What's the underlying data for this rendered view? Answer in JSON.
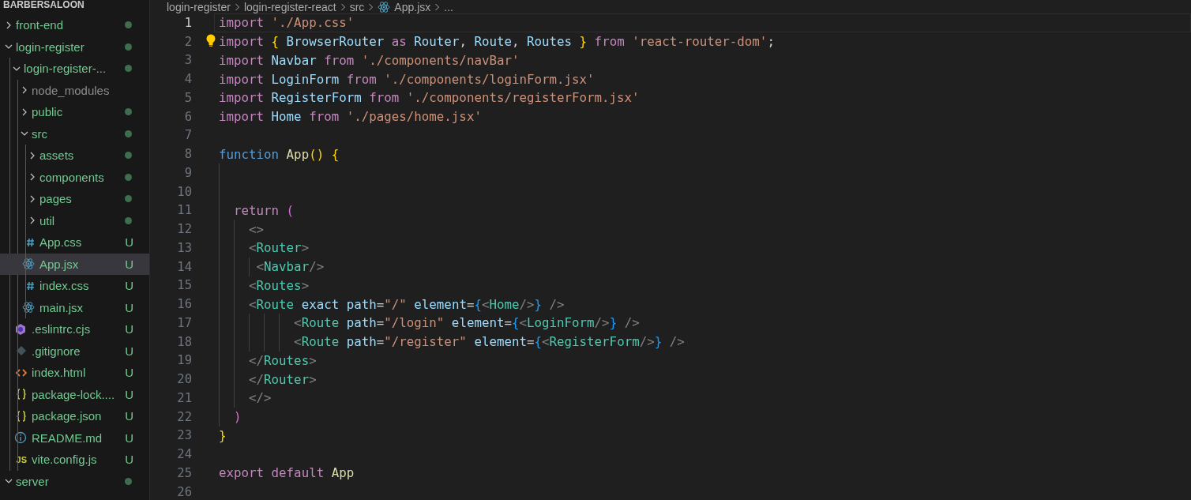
{
  "explorer": {
    "title": "BARBERSALOON",
    "tree": [
      {
        "name": "front-end",
        "kind": "folder",
        "expanded": false,
        "dot": true
      },
      {
        "name": "login-register",
        "kind": "folder",
        "expanded": true,
        "dot": true,
        "children": [
          {
            "name": "login-register-...",
            "kind": "folder",
            "expanded": true,
            "dot": true,
            "children": [
              {
                "name": "node_modules",
                "kind": "folder",
                "expanded": false,
                "dot": false,
                "dimmed": true
              },
              {
                "name": "public",
                "kind": "folder",
                "expanded": false,
                "dot": true
              },
              {
                "name": "src",
                "kind": "folder",
                "expanded": true,
                "dot": true,
                "children": [
                  {
                    "name": "assets",
                    "kind": "folder",
                    "expanded": false,
                    "dot": true
                  },
                  {
                    "name": "components",
                    "kind": "folder",
                    "expanded": false,
                    "dot": true
                  },
                  {
                    "name": "pages",
                    "kind": "folder",
                    "expanded": false,
                    "dot": true
                  },
                  {
                    "name": "util",
                    "kind": "folder",
                    "expanded": false,
                    "dot": true
                  },
                  {
                    "name": "App.css",
                    "kind": "css",
                    "badge": "U",
                    "selected": false
                  },
                  {
                    "name": "App.jsx",
                    "kind": "react",
                    "badge": "U",
                    "selected": true
                  },
                  {
                    "name": "index.css",
                    "kind": "css",
                    "badge": "U",
                    "selected": false
                  },
                  {
                    "name": "main.jsx",
                    "kind": "react",
                    "badge": "U",
                    "selected": false
                  }
                ]
              },
              {
                "name": ".eslintrc.cjs",
                "kind": "eslint",
                "badge": "U",
                "selected": false
              },
              {
                "name": ".gitignore",
                "kind": "git",
                "badge": "U",
                "selected": false
              },
              {
                "name": "index.html",
                "kind": "html",
                "badge": "U",
                "selected": false
              },
              {
                "name": "package-lock....",
                "kind": "json",
                "badge": "U",
                "selected": false
              },
              {
                "name": "package.json",
                "kind": "json",
                "badge": "U",
                "selected": false
              },
              {
                "name": "README.md",
                "kind": "info",
                "badge": "U",
                "selected": false
              },
              {
                "name": "vite.config.js",
                "kind": "js",
                "glyph": "JS",
                "badge": "U",
                "selected": false
              }
            ]
          }
        ]
      },
      {
        "name": "server",
        "kind": "folder",
        "expanded": true,
        "dot": true
      }
    ]
  },
  "breadcrumb": [
    {
      "text": "login-register",
      "kind": "folder"
    },
    {
      "text": "login-register-react",
      "kind": "folder"
    },
    {
      "text": "src",
      "kind": "folder"
    },
    {
      "text": "App.jsx",
      "kind": "react"
    },
    {
      "text": "...",
      "kind": "more"
    }
  ],
  "editor": {
    "lines": [
      {
        "number": "1",
        "active": true,
        "tokens": [
          {
            "kind": "keyword",
            "text": "import"
          },
          {
            "kind": "string",
            "text": " './App.css'"
          }
        ]
      },
      {
        "number": "2",
        "active": false,
        "lightbulb": true,
        "tokens": [
          {
            "kind": "keyword",
            "text": "import"
          },
          {
            "kind": "brace1",
            "text": " {"
          },
          {
            "kind": "variable",
            "text": " BrowserRouter "
          },
          {
            "kind": "keyword",
            "text": "as"
          },
          {
            "kind": "variable",
            "text": " Router"
          },
          {
            "kind": "plain",
            "text": ", "
          },
          {
            "kind": "variable",
            "text": "Route"
          },
          {
            "kind": "plain",
            "text": ", "
          },
          {
            "kind": "variable",
            "text": "Routes "
          },
          {
            "kind": "brace1",
            "text": "}"
          },
          {
            "kind": "keyword",
            "text": " from"
          },
          {
            "kind": "string",
            "text": " 'react-router-dom'"
          },
          {
            "kind": "plain",
            "text": ";"
          }
        ]
      },
      {
        "number": "3",
        "active": false,
        "tokens": [
          {
            "kind": "keyword",
            "text": "import"
          },
          {
            "kind": "variable",
            "text": " Navbar "
          },
          {
            "kind": "keyword",
            "text": "from"
          },
          {
            "kind": "string",
            "text": " './components/navBar'"
          }
        ]
      },
      {
        "number": "4",
        "active": false,
        "tokens": [
          {
            "kind": "keyword",
            "text": "import"
          },
          {
            "kind": "variable",
            "text": " LoginForm "
          },
          {
            "kind": "keyword",
            "text": "from"
          },
          {
            "kind": "string",
            "text": " './components/loginForm.jsx'"
          }
        ]
      },
      {
        "number": "5",
        "active": false,
        "tokens": [
          {
            "kind": "keyword",
            "text": "import"
          },
          {
            "kind": "variable",
            "text": " RegisterForm "
          },
          {
            "kind": "keyword",
            "text": "from"
          },
          {
            "kind": "string",
            "text": " './components/registerForm.jsx'"
          }
        ]
      },
      {
        "number": "6",
        "active": false,
        "tokens": [
          {
            "kind": "keyword",
            "text": "import"
          },
          {
            "kind": "variable",
            "text": " Home "
          },
          {
            "kind": "keyword",
            "text": "from"
          },
          {
            "kind": "string",
            "text": " './pages/home.jsx'"
          }
        ]
      },
      {
        "number": "7",
        "active": false
      },
      {
        "number": "8",
        "active": false,
        "tokens": [
          {
            "kind": "storage",
            "text": "function"
          },
          {
            "kind": "function",
            "text": " App"
          },
          {
            "kind": "brace1",
            "text": "()"
          },
          {
            "kind": "brace1",
            "text": " {"
          }
        ]
      },
      {
        "number": "9",
        "active": false,
        "indent_guide": true
      },
      {
        "number": "10",
        "active": false,
        "indent_guide": true
      },
      {
        "number": "11",
        "active": false,
        "tokens": [
          {
            "kind": "keyword",
            "text": "  return"
          },
          {
            "kind": "brace2",
            "text": " ("
          }
        ]
      },
      {
        "number": "12",
        "active": false,
        "tokens": [
          {
            "kind": "tagpunct",
            "text": "    <>"
          }
        ]
      },
      {
        "number": "13",
        "active": false,
        "tokens": [
          {
            "kind": "tagpunct",
            "text": "    <"
          },
          {
            "kind": "tag",
            "text": "Router"
          },
          {
            "kind": "tagpunct",
            "text": ">"
          }
        ]
      },
      {
        "number": "14",
        "active": false,
        "tokens": [
          {
            "kind": "tagpunct",
            "text": "     <"
          },
          {
            "kind": "tag",
            "text": "Navbar"
          },
          {
            "kind": "tagpunct",
            "text": "/>"
          }
        ]
      },
      {
        "number": "15",
        "active": false,
        "tokens": [
          {
            "kind": "tagpunct",
            "text": "    <"
          },
          {
            "kind": "tag",
            "text": "Routes"
          },
          {
            "kind": "tagpunct",
            "text": ">"
          }
        ]
      },
      {
        "number": "16",
        "active": false,
        "tokens": [
          {
            "kind": "tagpunct",
            "text": "    <"
          },
          {
            "kind": "tag",
            "text": "Route"
          },
          {
            "kind": "attr",
            "text": " exact path"
          },
          {
            "kind": "plain",
            "text": "="
          },
          {
            "kind": "string",
            "text": "\"/\""
          },
          {
            "kind": "attr",
            "text": " element"
          },
          {
            "kind": "plain",
            "text": "="
          },
          {
            "kind": "brace3",
            "text": "{"
          },
          {
            "kind": "tagpunct",
            "text": "<"
          },
          {
            "kind": "tag",
            "text": "Home"
          },
          {
            "kind": "tagpunct",
            "text": "/>"
          },
          {
            "kind": "brace3",
            "text": "}"
          },
          {
            "kind": "tagpunct",
            "text": " />"
          }
        ]
      },
      {
        "number": "17",
        "active": false,
        "tokens": [
          {
            "kind": "tagpunct",
            "text": "          <"
          },
          {
            "kind": "tag",
            "text": "Route"
          },
          {
            "kind": "attr",
            "text": " path"
          },
          {
            "kind": "plain",
            "text": "="
          },
          {
            "kind": "string",
            "text": "\"/login\""
          },
          {
            "kind": "attr",
            "text": " element"
          },
          {
            "kind": "plain",
            "text": "="
          },
          {
            "kind": "brace3",
            "text": "{"
          },
          {
            "kind": "tagpunct",
            "text": "<"
          },
          {
            "kind": "tag",
            "text": "LoginForm"
          },
          {
            "kind": "tagpunct",
            "text": "/>"
          },
          {
            "kind": "brace3",
            "text": "}"
          },
          {
            "kind": "tagpunct",
            "text": " />"
          }
        ]
      },
      {
        "number": "18",
        "active": false,
        "tokens": [
          {
            "kind": "tagpunct",
            "text": "          <"
          },
          {
            "kind": "tag",
            "text": "Route"
          },
          {
            "kind": "attr",
            "text": " path"
          },
          {
            "kind": "plain",
            "text": "="
          },
          {
            "kind": "string",
            "text": "\"/register\""
          },
          {
            "kind": "attr",
            "text": " element"
          },
          {
            "kind": "plain",
            "text": "="
          },
          {
            "kind": "brace3",
            "text": "{"
          },
          {
            "kind": "tagpunct",
            "text": "<"
          },
          {
            "kind": "tag",
            "text": "RegisterForm"
          },
          {
            "kind": "tagpunct",
            "text": "/>"
          },
          {
            "kind": "brace3",
            "text": "}"
          },
          {
            "kind": "tagpunct",
            "text": " />"
          }
        ]
      },
      {
        "number": "19",
        "active": false,
        "tokens": [
          {
            "kind": "tagpunct",
            "text": "    </"
          },
          {
            "kind": "tag",
            "text": "Routes"
          },
          {
            "kind": "tagpunct",
            "text": ">"
          }
        ]
      },
      {
        "number": "20",
        "active": false,
        "tokens": [
          {
            "kind": "tagpunct",
            "text": "    </"
          },
          {
            "kind": "tag",
            "text": "Router"
          },
          {
            "kind": "tagpunct",
            "text": ">"
          }
        ]
      },
      {
        "number": "21",
        "active": false,
        "tokens": [
          {
            "kind": "tagpunct",
            "text": "    </>"
          }
        ]
      },
      {
        "number": "22",
        "active": false,
        "tokens": [
          {
            "kind": "brace2",
            "text": "  )"
          }
        ]
      },
      {
        "number": "23",
        "active": false,
        "tokens": [
          {
            "kind": "brace1",
            "text": "}"
          }
        ]
      },
      {
        "number": "24",
        "active": false
      },
      {
        "number": "25",
        "active": false,
        "tokens": [
          {
            "kind": "keyword",
            "text": "export"
          },
          {
            "kind": "keyword",
            "text": " default"
          },
          {
            "kind": "function",
            "text": " App"
          }
        ]
      },
      {
        "number": "26",
        "active": false
      }
    ]
  }
}
